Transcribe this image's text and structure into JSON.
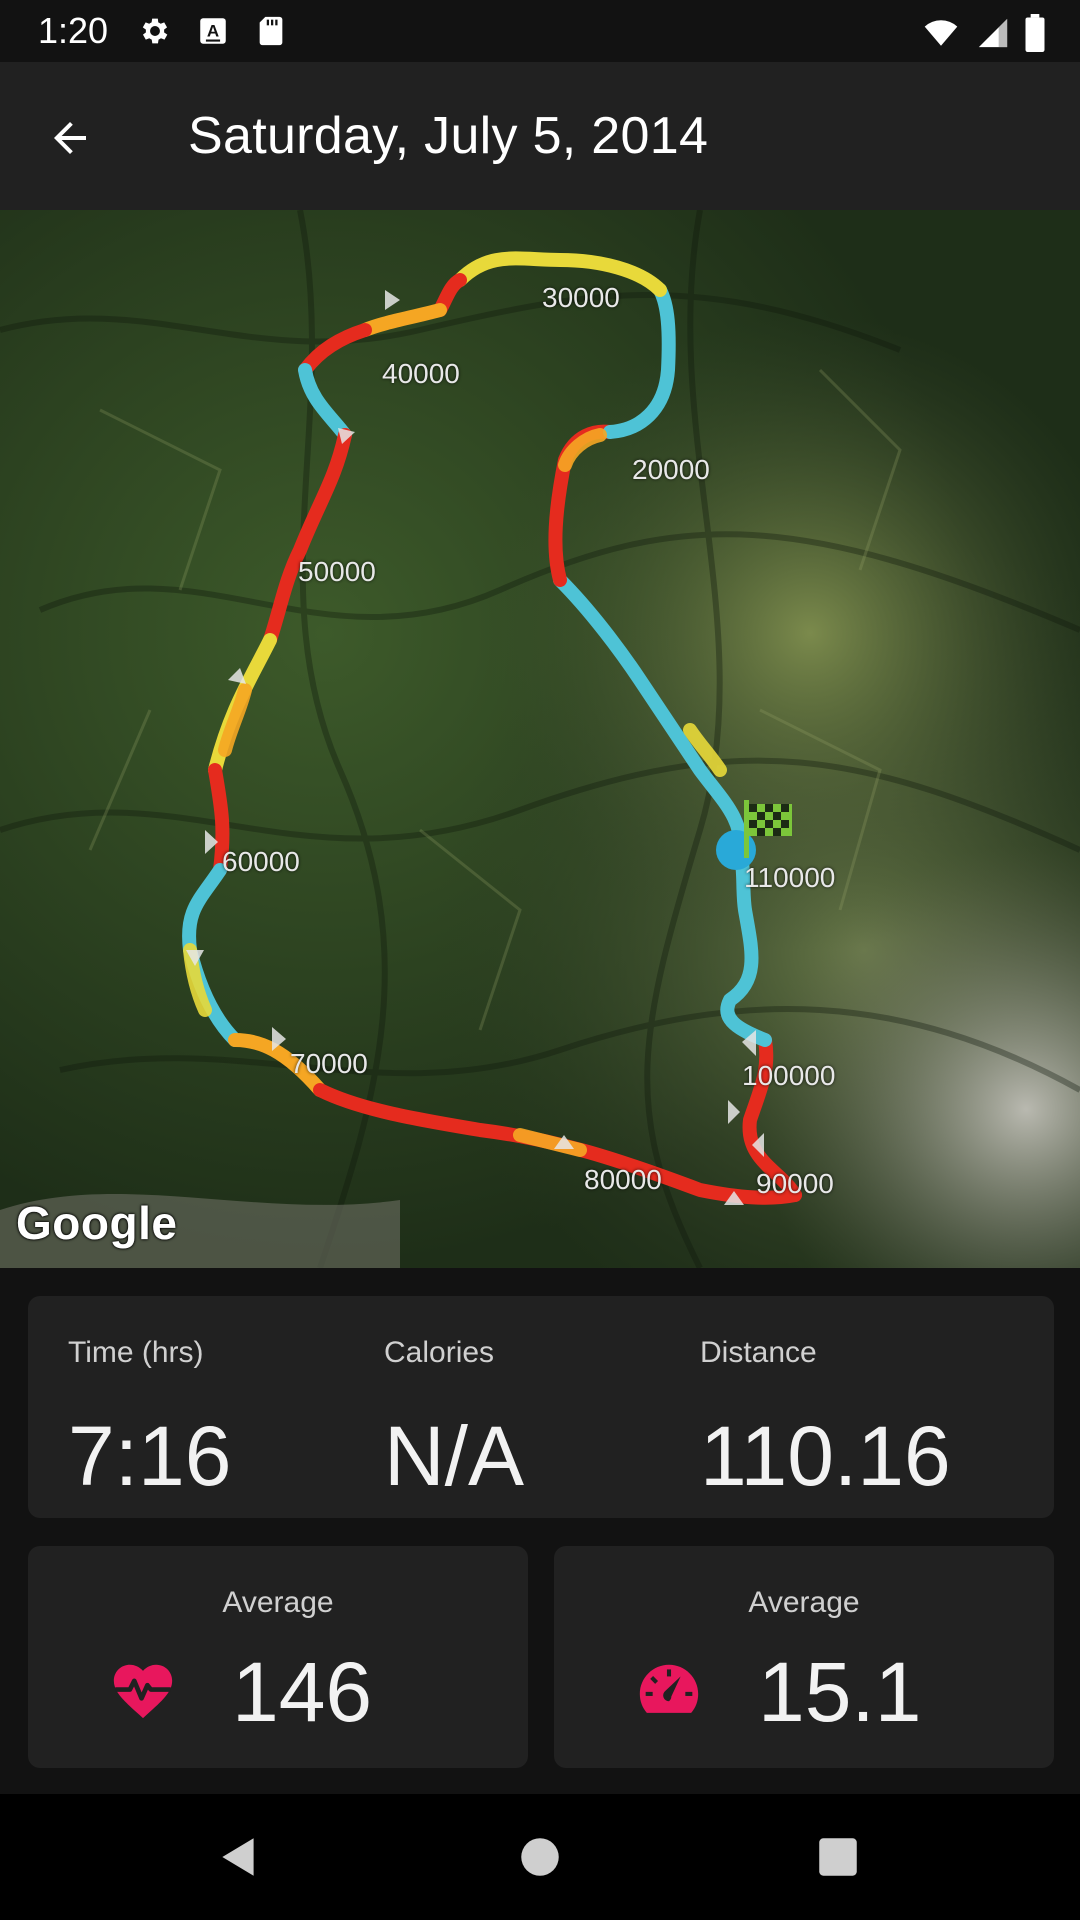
{
  "status_bar": {
    "time": "1:20",
    "left_icons": [
      "gear-icon",
      "a-badge-icon",
      "sd-card-icon"
    ],
    "right_icons": [
      "wifi-icon",
      "cell-signal-icon",
      "battery-icon"
    ]
  },
  "app_bar": {
    "back_icon": "arrow-left-icon",
    "title": "Saturday, July 5, 2014"
  },
  "map": {
    "attribution": "Google",
    "distance_markers": [
      "30000",
      "40000",
      "20000",
      "50000",
      "60000",
      "70000",
      "80000",
      "90000",
      "100000",
      "110000"
    ],
    "finish_icon": "checkered-flag-icon",
    "route_colors": [
      "#e52b1e",
      "#f5a623",
      "#e8d93a",
      "#4ec3d6"
    ]
  },
  "stats": {
    "time_label": "Time (hrs)",
    "time_value": "7:16",
    "calories_label": "Calories",
    "calories_value": "N/A",
    "distance_label": "Distance",
    "distance_value": "110.16",
    "heart_rate": {
      "label": "Average",
      "value": "146",
      "icon": "heart-pulse-icon",
      "color": "#e8175d"
    },
    "speed": {
      "label": "Average",
      "value": "15.1",
      "icon": "speedometer-icon",
      "color": "#e8175d"
    }
  },
  "nav_bar": {
    "back": "triangle-back-icon",
    "home": "circle-home-icon",
    "recents": "square-recents-icon"
  }
}
